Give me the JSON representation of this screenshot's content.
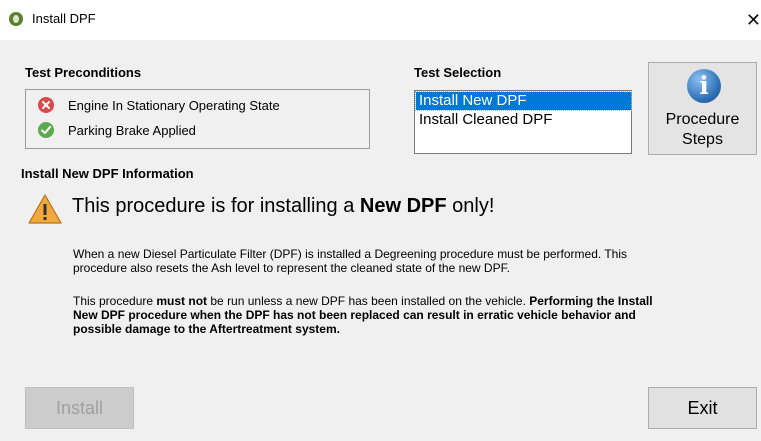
{
  "window": {
    "title": "Install DPF",
    "close_glyph": "✕"
  },
  "preconditions": {
    "heading": "Test Preconditions",
    "items": [
      {
        "label": "Engine In Stationary Operating State",
        "status": "failed",
        "icon": "error-icon",
        "color": "#d94a4a"
      },
      {
        "label": "Parking Brake Applied",
        "status": "passed",
        "icon": "check-icon",
        "color": "#5ea84f"
      }
    ]
  },
  "test_selection": {
    "heading": "Test Selection",
    "options": [
      "Install New DPF",
      "Install Cleaned DPF"
    ],
    "selected": "Install New DPF",
    "selected_color": "#0078d7"
  },
  "procedure_button": {
    "line1": "Procedure",
    "line2": "Steps",
    "icon": "info-icon"
  },
  "info": {
    "heading": "Install New DPF Information",
    "headline_pre": "This procedure is for installing a ",
    "headline_bold": "New DPF",
    "headline_post": " only!",
    "para1_line1": "When a new Diesel Particulate Filter (DPF) is installed a Degreening procedure must be performed. This",
    "para1_line2": "procedure also resets the Ash level to represent the cleaned state of the new DPF.",
    "para2_line1_pre": "This procedure ",
    "para2_line1_bold1": "must not",
    "para2_line1_mid": " be run unless a new DPF has been installed on the vehicle. ",
    "para2_line1_bold2": "Performing the Install",
    "para2_line2": "New DPF procedure when the DPF has not been replaced can result in erratic vehicle behavior and",
    "para2_line3": "possible damage to the Aftertreatment system."
  },
  "buttons": {
    "install": "Install",
    "exit": "Exit"
  }
}
